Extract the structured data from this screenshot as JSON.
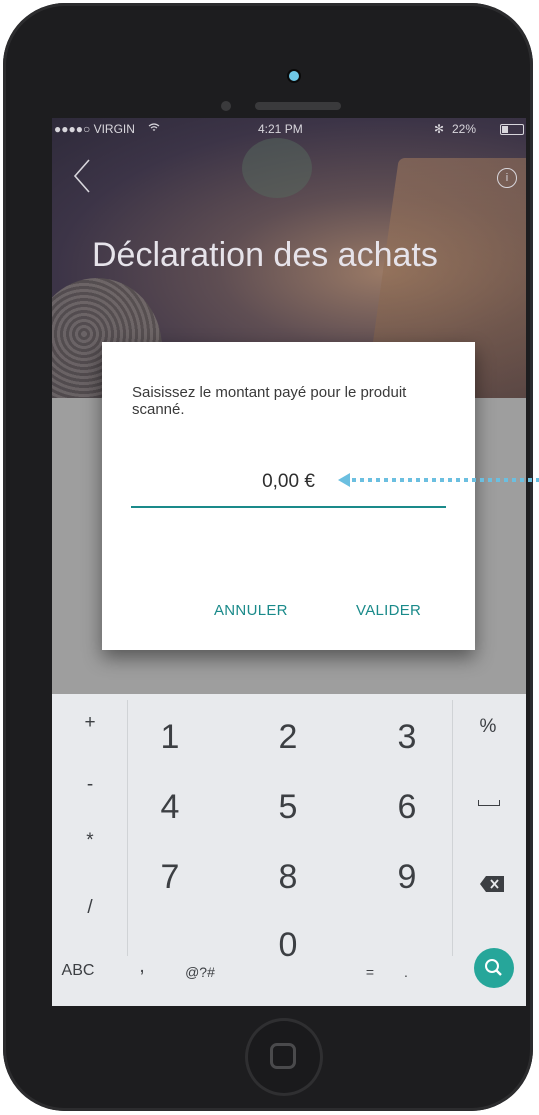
{
  "status_bar": {
    "carrier": "●●●●○ VIRGIN",
    "time": "4:21 PM",
    "battery": "22%"
  },
  "header": {
    "title": "Déclaration des achats"
  },
  "dialog": {
    "message": "Saisissez le montant payé pour le produit scanné.",
    "amount_value": "0,00 €",
    "cancel_label": "ANNULER",
    "confirm_label": "VALIDER"
  },
  "keyboard": {
    "left_ops": [
      "+",
      "-",
      "*",
      "/"
    ],
    "digits": [
      "1",
      "2",
      "3",
      "4",
      "5",
      "6",
      "7",
      "8",
      "9",
      "0"
    ],
    "right_keys": [
      "%",
      "space",
      "backspace",
      "search"
    ],
    "bottom": {
      "abc": "ABC",
      "comma": ",",
      "symbols": "@?#",
      "equals": "=",
      "dot": "."
    }
  },
  "colors": {
    "accent": "#1a8a8a",
    "search_key": "#26a69a",
    "annotation": "#6bbfe0"
  }
}
